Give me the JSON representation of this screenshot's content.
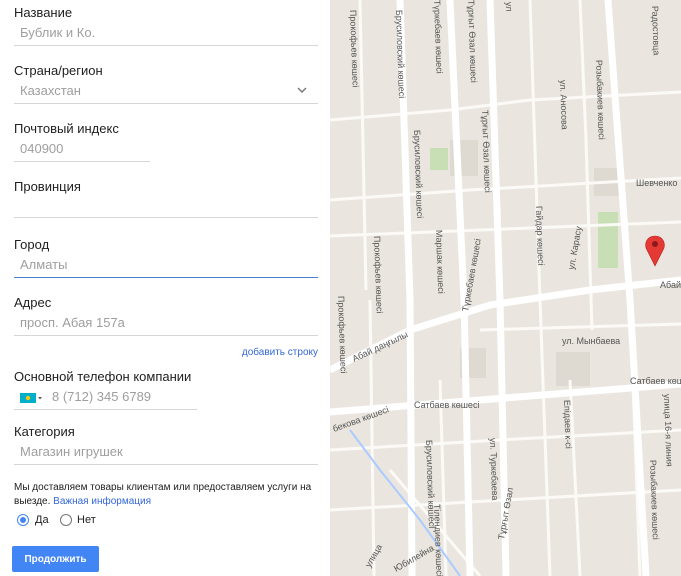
{
  "form": {
    "name": {
      "label": "Название",
      "placeholder": "Бублик и Ко."
    },
    "country": {
      "label": "Страна/регион",
      "value": "Казахстан"
    },
    "postal": {
      "label": "Почтовый индекс",
      "value": "040900"
    },
    "province": {
      "label": "Провинция",
      "value": ""
    },
    "city": {
      "label": "Город",
      "value": "Алматы"
    },
    "address": {
      "label": "Адрес",
      "value": "просп. Абая 157а",
      "add_line": "добавить строку"
    },
    "phone": {
      "label": "Основной телефон компании",
      "value": "8 (712) 345 6789"
    },
    "category": {
      "label": "Категория",
      "value": "Магазин игрушек"
    },
    "delivery": {
      "text": "Мы доставляем товары клиентам или предоставляем услуги на выезде.",
      "link": "Важная информация",
      "yes": "Да",
      "no": "Нет",
      "selected": "yes"
    },
    "continue_label": "Продолжить"
  },
  "colors": {
    "accent": "#4285f4",
    "link": "#3367d6",
    "map_bg": "#eae6df",
    "marker": "#e53935"
  },
  "map": {
    "streets": {
      "prokofiev_top": "Прокофьев көшесі",
      "brusilovsky": "Брусиловский көшесі",
      "turkeyev_top": "Түркебаев көшесі",
      "tyrgyt_ozal_top": "Тұрғыт Өзал көшесі",
      "tyrgyt_ozal_mid": "Тұрғыт Өзал көшесі",
      "ul_short": "ул",
      "radostovca": "Радостовца",
      "rozybakiev": "Розыбакиев көшесі",
      "ul_anosova": "ул. Аносова",
      "shevchenko": "Шевченко",
      "gaidar": "Гайдар көшесі",
      "ul_karasu": "ул. Карасу",
      "prokofiev_mid": "Прокофьев көшесі",
      "marshak": "Маршак көшесі",
      "abai_right": "Абай",
      "abai": "Абай даңғылы",
      "turkeyev_mid": "Түркебаев көшесі",
      "ul_mynbaeva": "ул. Мынбаева",
      "satbaev_right": "Сатбаев көшесі",
      "satbaev": "Сатбаев көшесі",
      "epidaeva": "Епідаев к-сі",
      "ulitsa_16": "улица 16-я линия",
      "rozybakiev_bottom": "Розыбакиев көшесі",
      "ul_turkebaeva": "ул. Туркебаева",
      "tlendiev": "Тілендиев көшесі",
      "tyrgyt_ozal_bottom": "Тұрғыт Өзал",
      "ulitsa_bottom": "улица",
      "yubileynaya": "Юбилейна",
      "left_vertical": "Прокофьев көшесі",
      "left_bottom": "бекова көшесі"
    }
  }
}
